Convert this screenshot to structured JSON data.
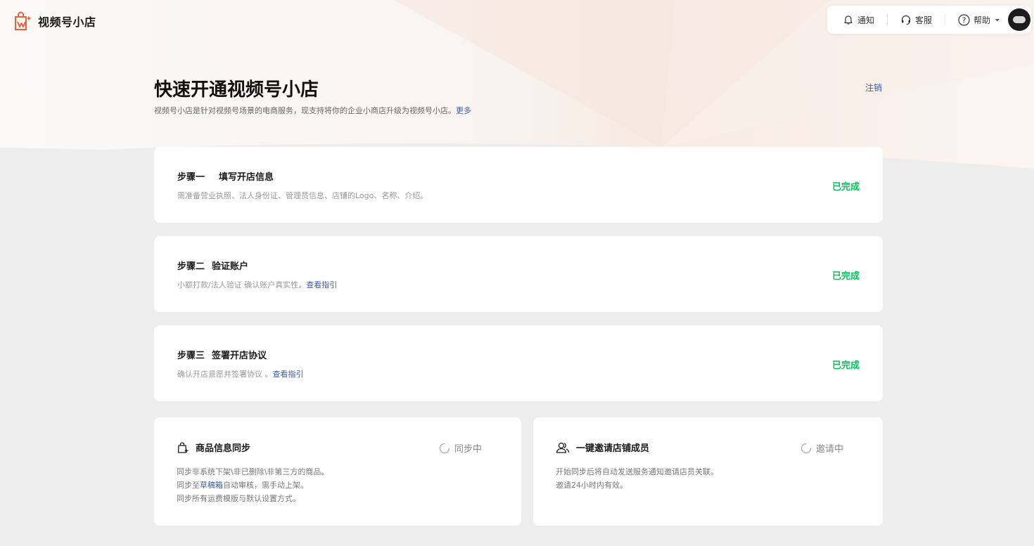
{
  "header": {
    "brand_name": "视频号小店",
    "notify_label": "通知",
    "service_label": "客服",
    "help_label": "帮助"
  },
  "page": {
    "title": "快速开通视频号小店",
    "description": "视频号小店是针对视频号场景的电商服务，现支持将你的企业小商店升级为视频号小店。",
    "more_link": "更多",
    "logout_label": "注销"
  },
  "steps": [
    {
      "number": "步骤一",
      "title": "填写开店信息",
      "description": "需准备营业执照、法人身份证、管理员信息、店铺的Logo、名称、介绍。",
      "link": "",
      "status": "已完成"
    },
    {
      "number": "步骤二",
      "title": "验证账户",
      "description": "小额打款/法人验证 确认账户真实性。",
      "link": "查看指引",
      "status": "已完成"
    },
    {
      "number": "步骤三",
      "title": "签署开店协议",
      "description": "确认开店意愿并签署协议 。",
      "link": "查看指引",
      "status": "已完成"
    }
  ],
  "sync_card": {
    "title": "商品信息同步",
    "status": "同步中",
    "line1": "同步非系统下架\\非已删除\\非第三方的商品。",
    "line2_prefix": "同步至",
    "line2_link": "草稿箱",
    "line2_suffix": "自动审核，需手动上架。",
    "line3": "同步所有运费模版与默认设置方式。"
  },
  "invite_card": {
    "title": "一键邀请店铺成员",
    "status": "邀请中",
    "line1": "开始同步后将自动发送服务通知邀请店员关联。",
    "line2": "邀请24小时内有效。"
  },
  "colors": {
    "accent_link": "#3b5ba5",
    "success": "#07c160",
    "brand": "#f0603a"
  }
}
